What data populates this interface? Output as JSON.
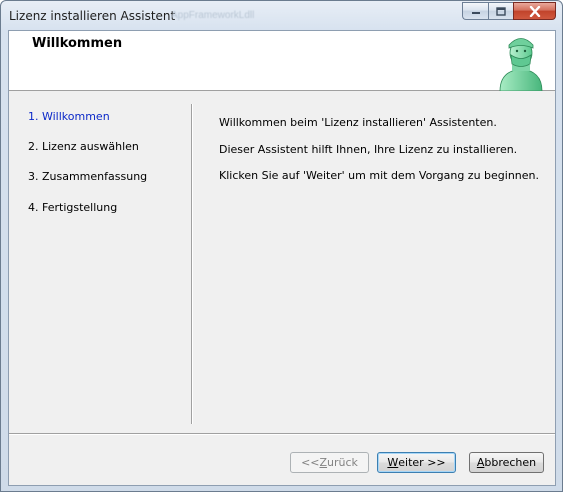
{
  "window": {
    "title": "Lizenz installieren Assistent",
    "title_ghost": "AppFrameworkLdll"
  },
  "header": {
    "title": "Willkommen",
    "icon": "surgeon-person-icon"
  },
  "steps": [
    {
      "label": "1. Willkommen",
      "active": true
    },
    {
      "label": "2. Lizenz auswählen",
      "active": false
    },
    {
      "label": "3. Zusammenfassung",
      "active": false
    },
    {
      "label": "4. Fertigstellung",
      "active": false
    }
  ],
  "content": {
    "line1": "Willkommen beim 'Lizenz installieren' Assistenten.",
    "line2": "Dieser Assistent hilft Ihnen, Ihre Lizenz zu installieren.",
    "line3": "Klicken Sie auf 'Weiter' um mit dem Vorgang zu beginnen."
  },
  "buttons": {
    "back": {
      "prefix": "<< ",
      "mnemonic": "Z",
      "rest": "urück",
      "enabled": false
    },
    "next": {
      "mnemonic": "W",
      "rest": "eiter >>",
      "enabled": true
    },
    "cancel": {
      "mnemonic": "A",
      "rest": "bbrechen",
      "enabled": true
    }
  },
  "colors": {
    "active_step": "#0b28c8",
    "close_button": "#c1432b",
    "icon_green": "#7fd6a8"
  }
}
